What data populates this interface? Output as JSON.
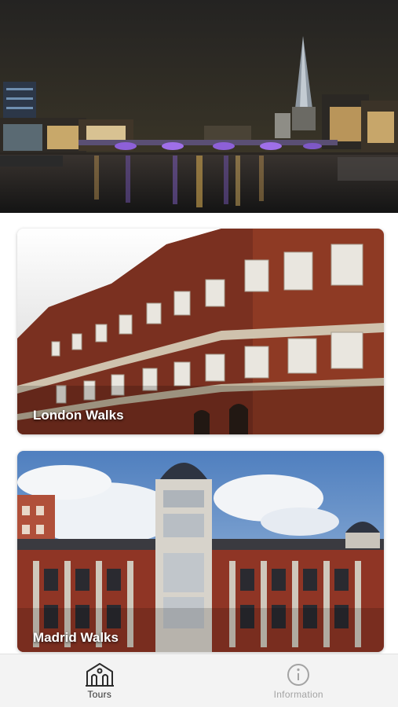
{
  "tours": [
    {
      "title": "London Walks"
    },
    {
      "title": "Madrid Walks"
    }
  ],
  "bottom_nav": {
    "active_index": 0,
    "items": [
      {
        "label": "Tours",
        "icon": "building-icon"
      },
      {
        "label": "Information",
        "icon": "info-circle-icon"
      }
    ]
  },
  "colors": {
    "nav_background": "#f3f3f3",
    "nav_active": "#2b2b2b",
    "nav_inactive": "#a3a3a3",
    "card_title": "#ffffff"
  }
}
